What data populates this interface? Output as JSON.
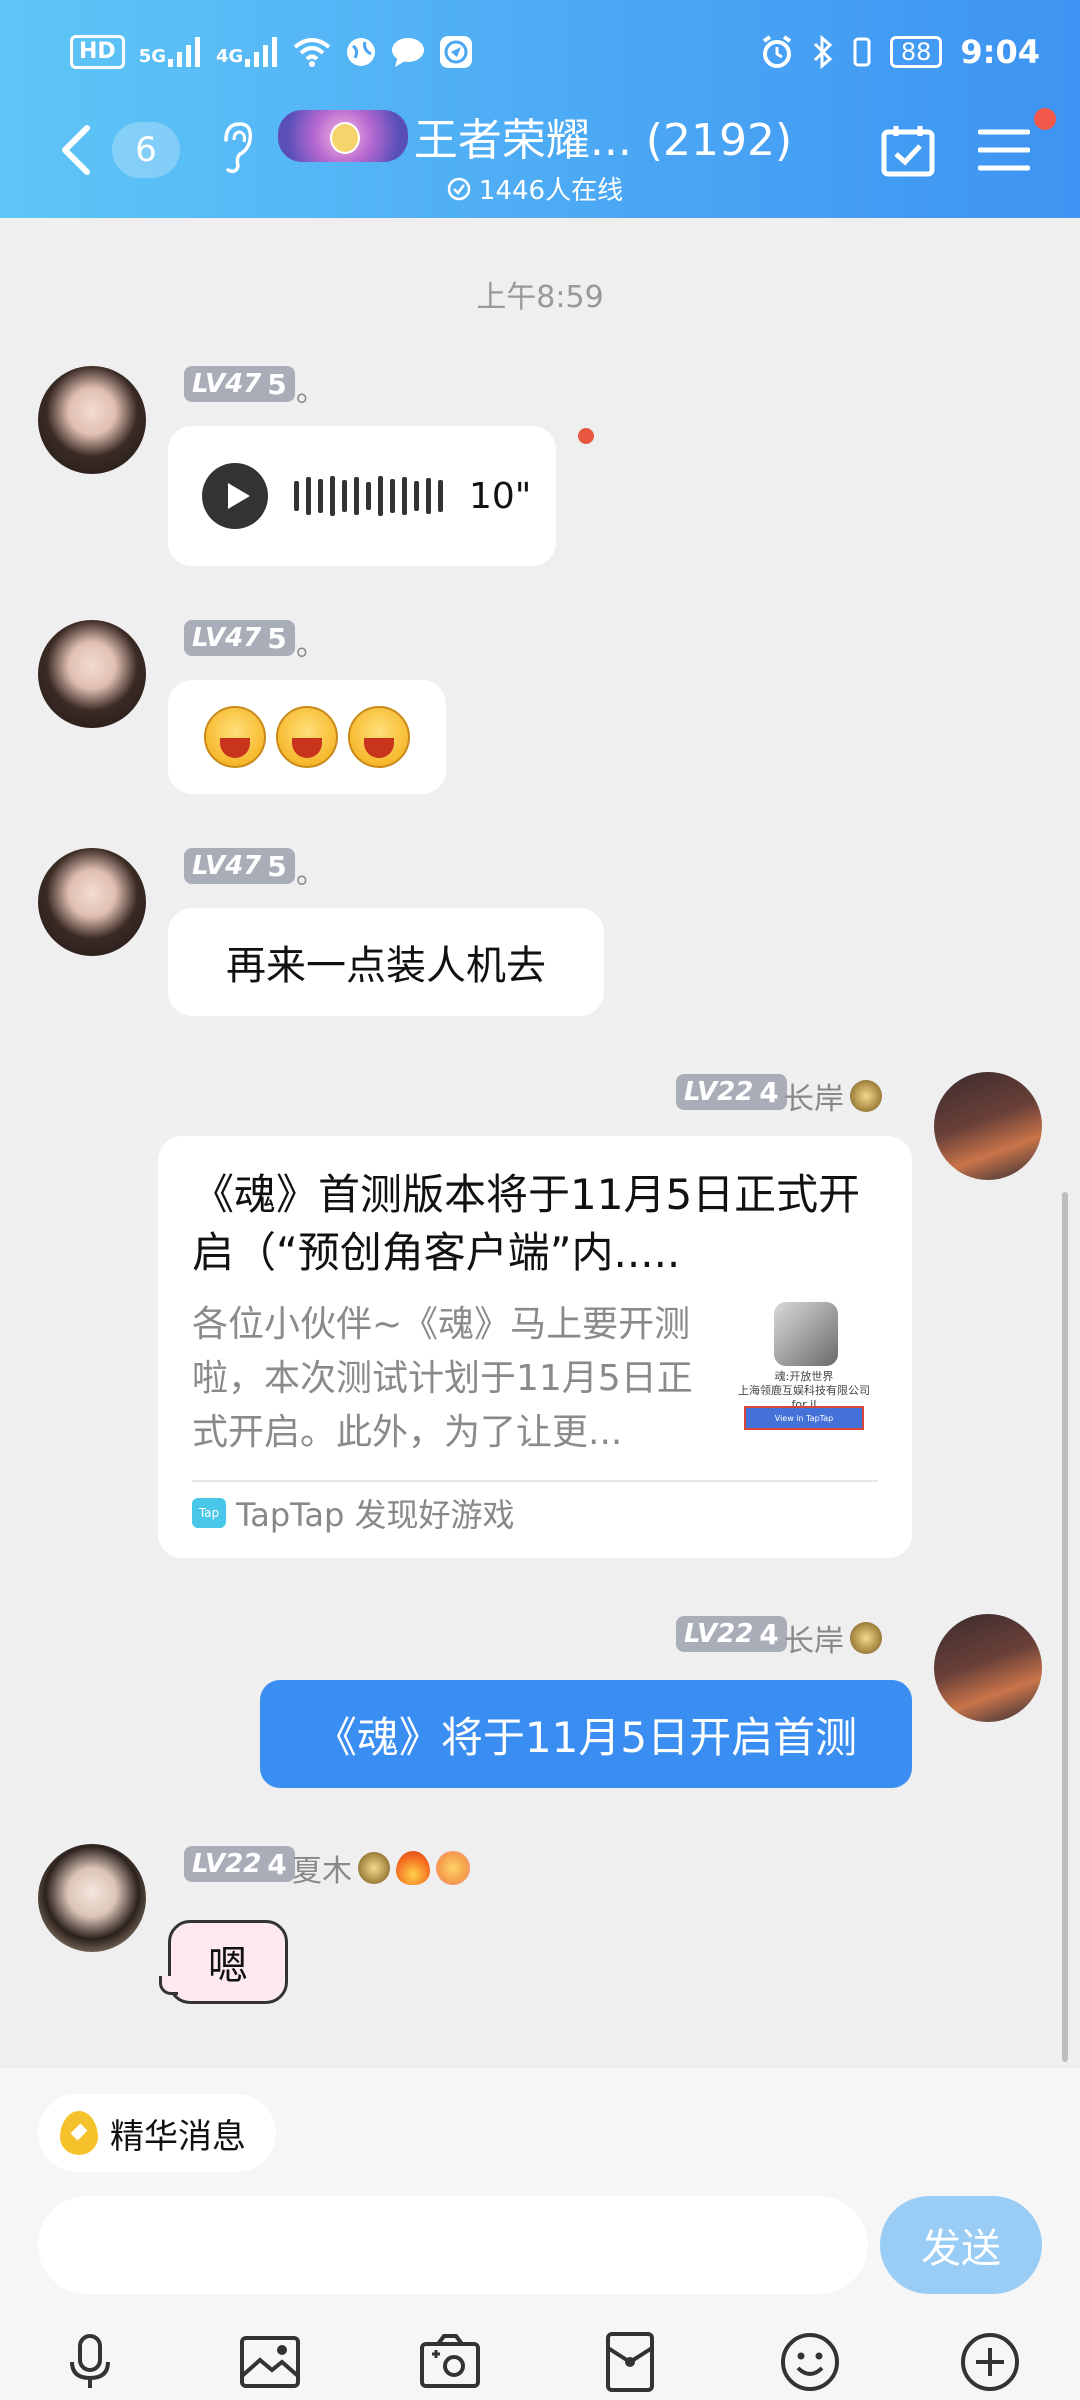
{
  "status_bar": {
    "hd": "HD",
    "sim1": "5G",
    "sim2": "4G",
    "battery": "88",
    "time": "9:04"
  },
  "header": {
    "unread_count": "6",
    "group_title": "王者荣耀... (2192)",
    "online_text": "1446人在线",
    "accent_color": "#4aa6f4"
  },
  "chat": {
    "timestamp": "上午8:59",
    "messages": [
      {
        "type": "voice",
        "level": "LV47",
        "level_num": "5",
        "nickname": "。",
        "duration": "10\""
      },
      {
        "type": "emoji",
        "level": "LV47",
        "level_num": "5",
        "nickname": "。",
        "emoji_icons": [
          "laugh-emoji",
          "laugh-emoji",
          "laugh-emoji"
        ]
      },
      {
        "type": "text",
        "level": "LV47",
        "level_num": "5",
        "nickname": "。",
        "text": "再来一点装人机去"
      },
      {
        "type": "share_card",
        "level": "LV22",
        "level_num": "4",
        "nickname": "长岸",
        "card_title": "《魂》首测版本将于11月5日正式开启（“预创角客户端”内.....",
        "card_body": "各位小伙伴~《魂》马上要开测啦，本次测试计划于11月5日正式开启。此外，为了让更...",
        "thumb_line1": "魂:开放世界",
        "thumb_line2": "上海领鹿互娱科技有限公司 for iI",
        "thumb_button": "View in TapTap",
        "source": "TapTap 发现好游戏",
        "source_icon_text": "Tap"
      },
      {
        "type": "text_self",
        "level": "LV22",
        "level_num": "4",
        "nickname": "长岸",
        "text": "《魂》将于11月5日开启首测"
      },
      {
        "type": "text",
        "level": "LV22",
        "level_num": "4",
        "nickname": "夏木",
        "text": "嗯"
      }
    ]
  },
  "bottom": {
    "essence_label": "精华消息",
    "input_placeholder": "",
    "send_label": "发送",
    "toolbar_icons": [
      "microphone-icon",
      "image-icon",
      "camera-icon",
      "red-packet-icon",
      "emoji-icon",
      "plus-icon"
    ]
  }
}
